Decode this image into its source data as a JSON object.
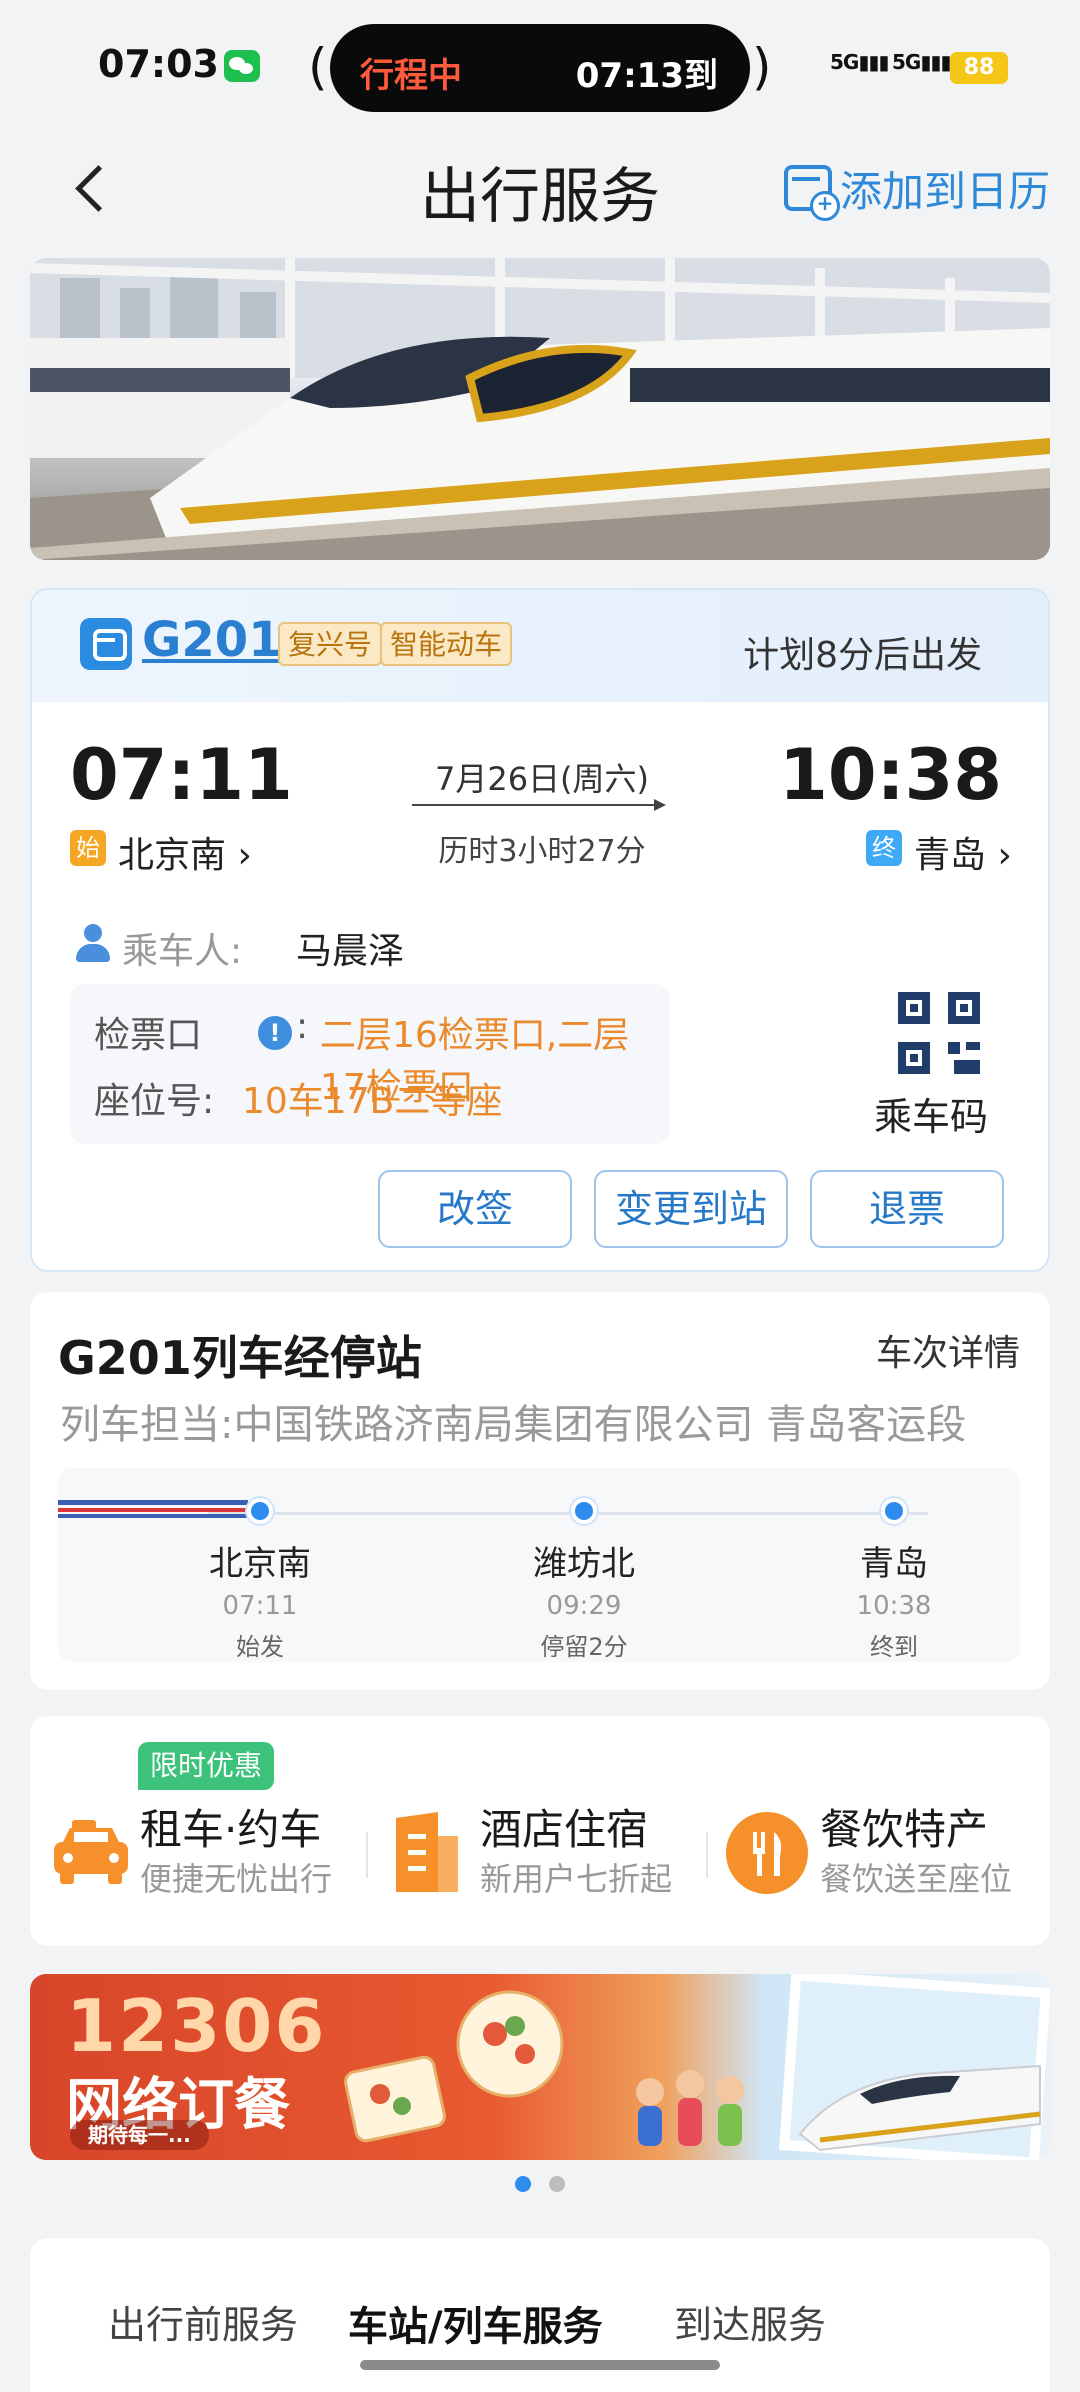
{
  "status_bar": {
    "time": "07:03",
    "island_status": "行程中",
    "island_eta": "07:13到",
    "signal1": "5G",
    "signal2": "5G",
    "battery": "88"
  },
  "nav": {
    "title": "出行服务",
    "add_calendar": "添加到日历"
  },
  "ticket": {
    "train_no": "G201",
    "tags": [
      "复兴号",
      "智能动车"
    ],
    "depart_info": "计划8分后出发",
    "depart_time": "07:11",
    "arrive_time": "10:38",
    "date": "7月26日(周六)",
    "duration": "历时3小时27分",
    "from_badge": "始",
    "from_station": "北京南 ›",
    "to_badge": "终",
    "to_station": "青岛 ›",
    "passenger_label": "乘车人:",
    "passenger_name": "马晨泽",
    "gate_label": "检票口",
    "gate_value": "二层16检票口,二层17检票口",
    "seat_label": "座位号:",
    "seat_value": "10车17B二等座",
    "qr_label": "乘车码",
    "actions": [
      "改签",
      "变更到站",
      "退票"
    ]
  },
  "stops": {
    "title": "G201列车经停站",
    "detail_link": "车次详情",
    "operator": "列车担当:中国铁路济南局集团有限公司 青岛客运段",
    "list": [
      {
        "name": "北京南",
        "time": "07:11",
        "note": "始发"
      },
      {
        "name": "潍坊北",
        "time": "09:29",
        "note": "停留2分"
      },
      {
        "name": "青岛",
        "time": "10:38",
        "note": "终到"
      }
    ]
  },
  "services": {
    "promo": "限时优惠",
    "items": [
      {
        "title": "租车·约车",
        "sub": "便捷无忧出行",
        "icon": "car-icon"
      },
      {
        "title": "酒店住宿",
        "sub": "新用户七折起",
        "icon": "hotel-icon"
      },
      {
        "title": "餐饮特产",
        "sub": "餐饮送至座位",
        "icon": "food-icon"
      }
    ]
  },
  "banner": {
    "line1": "12306",
    "line2": "网络订餐",
    "pill": "期待每一..."
  },
  "tabs": [
    "出行前服务",
    "车站/列车服务",
    "到达服务"
  ],
  "colors": {
    "accent": "#2e8ad8",
    "orange": "#ea8a2c",
    "island_red": "#ff5a3c"
  }
}
